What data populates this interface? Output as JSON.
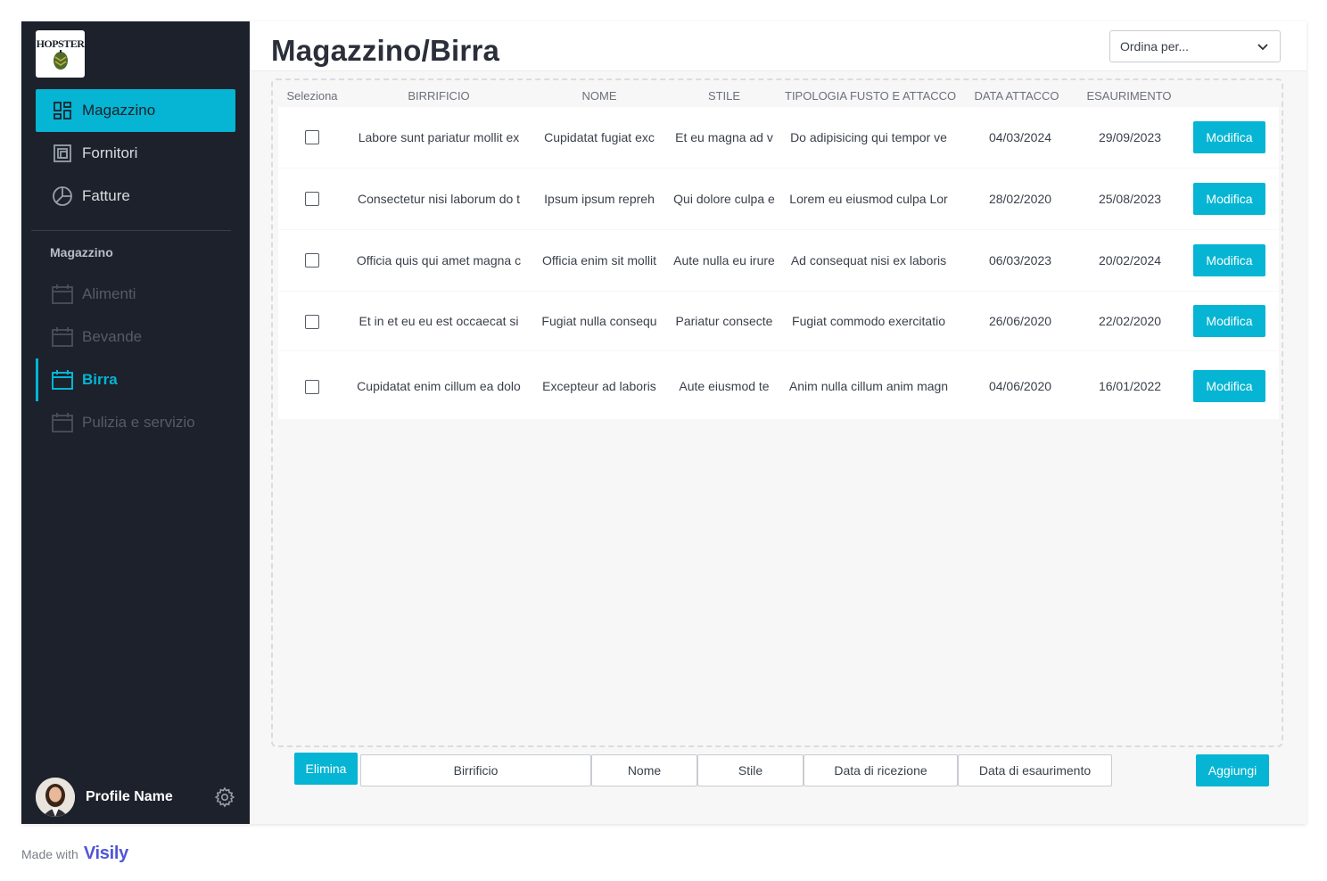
{
  "sidebar": {
    "logo_text": "HOPSTER",
    "main_nav": [
      {
        "label": "Magazzino",
        "icon": "dashboard-icon",
        "active": true
      },
      {
        "label": "Fornitori",
        "icon": "layers-icon",
        "active": false
      },
      {
        "label": "Fatture",
        "icon": "pie-chart-icon",
        "active": false
      }
    ],
    "section_title": "Magazzino",
    "sub_nav": [
      {
        "label": "Alimenti",
        "icon": "calendar-icon",
        "active": false
      },
      {
        "label": "Bevande",
        "icon": "calendar-icon",
        "active": false
      },
      {
        "label": "Birra",
        "icon": "calendar-icon",
        "active": true
      },
      {
        "label": "Pulizia e servizio",
        "icon": "calendar-icon",
        "active": false
      }
    ],
    "profile_name": "Profile Name"
  },
  "header": {
    "title": "Magazzino/Birra",
    "sort_placeholder": "Ordina per..."
  },
  "table": {
    "columns": [
      "Seleziona",
      "BIRRIFICIO",
      "NOME",
      "STILE",
      "TIPOLOGIA FUSTO E ATTACCO",
      "DATA ATTACCO",
      "ESAURIMENTO"
    ],
    "action_label": "Modifica",
    "rows": [
      {
        "birrificio": "Labore sunt pariatur mollit ex",
        "nome": "Cupidatat fugiat exc",
        "stile": "Et eu magna ad v",
        "tipologia": "Do adipisicing qui tempor ve",
        "data_attacco": "04/03/2024",
        "esaurimento": "29/09/2023"
      },
      {
        "birrificio": "Consectetur nisi laborum do t",
        "nome": "Ipsum ipsum repreh",
        "stile": "Qui dolore culpa e",
        "tipologia": "Lorem eu eiusmod culpa Lor",
        "data_attacco": "28/02/2020",
        "esaurimento": "25/08/2023"
      },
      {
        "birrificio": "Officia quis qui amet magna c",
        "nome": "Officia enim sit mollit",
        "stile": "Aute nulla eu irure",
        "tipologia": "Ad consequat nisi ex laboris",
        "data_attacco": "06/03/2023",
        "esaurimento": "20/02/2024"
      },
      {
        "birrificio": "Et in et eu eu est occaecat si",
        "nome": "Fugiat nulla consequ",
        "stile": "Pariatur consecte",
        "tipologia": "Fugiat commodo exercitatio",
        "data_attacco": "26/06/2020",
        "esaurimento": "22/02/2020"
      },
      {
        "birrificio": "Cupidatat enim cillum ea dolo",
        "nome": "Excepteur ad laboris",
        "stile": "Aute eiusmod te",
        "tipologia": "Anim nulla cillum anim magn",
        "data_attacco": "04/06/2020",
        "esaurimento": "16/01/2022"
      }
    ]
  },
  "footer": {
    "delete_label": "Elimina",
    "fields": [
      "Birrificio",
      "Nome",
      "Stile",
      "Data di ricezione",
      "Data di esaurimento"
    ],
    "add_label": "Aggiungi"
  },
  "watermark": {
    "prefix": "Made with",
    "brand": "Visily"
  },
  "colors": {
    "accent": "#05b5d3",
    "sidebar_bg": "#1c212b",
    "page_bg": "#f7f7f7"
  }
}
